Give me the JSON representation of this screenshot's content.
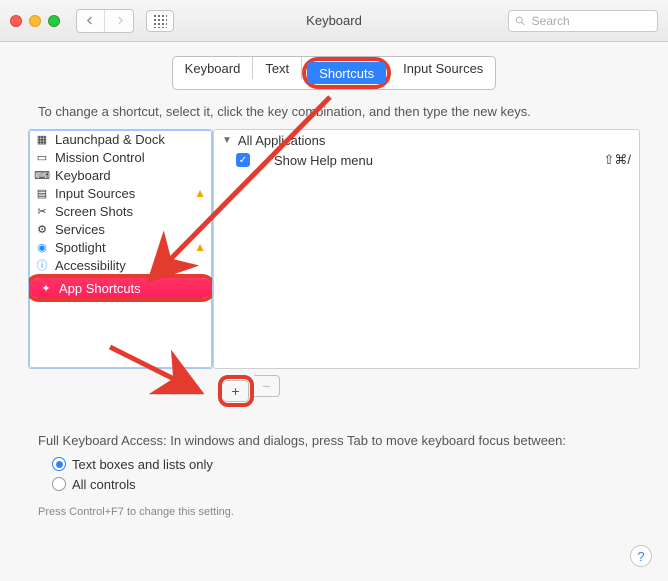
{
  "titlebar": {
    "title": "Keyboard"
  },
  "toolbar": {
    "search_placeholder": "Search"
  },
  "tabs": {
    "items": [
      {
        "label": "Keyboard",
        "selected": false
      },
      {
        "label": "Text",
        "selected": false
      },
      {
        "label": "Shortcuts",
        "selected": true
      },
      {
        "label": "Input Sources",
        "selected": false
      }
    ]
  },
  "instruction": "To change a shortcut, select it, click the key combination, and then type the new keys.",
  "categories": [
    {
      "label": "Launchpad & Dock",
      "icon": "launchpad",
      "warn": false
    },
    {
      "label": "Mission Control",
      "icon": "mission",
      "warn": false
    },
    {
      "label": "Keyboard",
      "icon": "keyboard",
      "warn": false
    },
    {
      "label": "Input Sources",
      "icon": "input",
      "warn": true
    },
    {
      "label": "Screen Shots",
      "icon": "camera",
      "warn": false
    },
    {
      "label": "Services",
      "icon": "gear",
      "warn": false
    },
    {
      "label": "Spotlight",
      "icon": "spotlight",
      "warn": true
    },
    {
      "label": "Accessibility",
      "icon": "accessibility",
      "warn": false
    },
    {
      "label": "App Shortcuts",
      "icon": "app",
      "warn": false,
      "selected": true
    }
  ],
  "shortcuts": {
    "group_label": "All Applications",
    "items": [
      {
        "label": "Show Help menu",
        "accelerator": "⇧⌘/",
        "checked": true
      }
    ]
  },
  "plusminus": {
    "plus": "+",
    "minus": "−"
  },
  "bottom": {
    "heading": "Full Keyboard Access: In windows and dialogs, press Tab to move keyboard focus between:",
    "options": [
      {
        "label": "Text boxes and lists only",
        "selected": true
      },
      {
        "label": "All controls",
        "selected": false
      }
    ],
    "hint": "Press Control+F7 to change this setting."
  },
  "help": {
    "label": "?"
  }
}
